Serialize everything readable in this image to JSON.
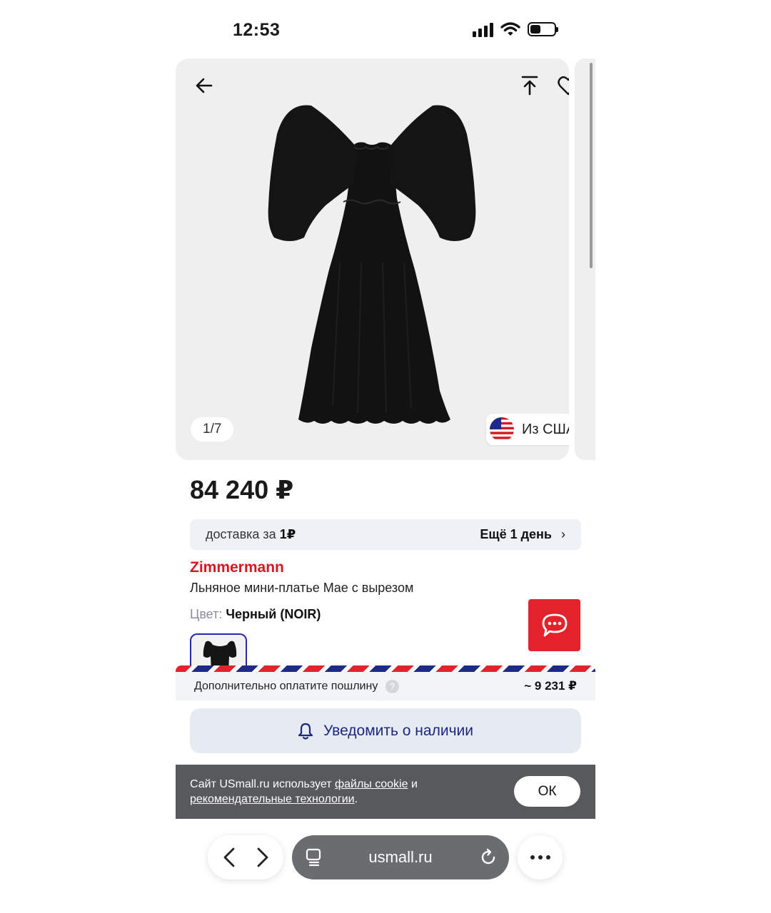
{
  "status_bar": {
    "time": "12:53",
    "battery_level": 0.45
  },
  "gallery": {
    "counter": "1/7",
    "origin_label": "Из США",
    "icons": [
      "arrow-left-icon",
      "share-up-icon",
      "heart-icon",
      "us-flag-icon"
    ]
  },
  "product": {
    "price": "84 240 ₽",
    "delivery": {
      "label": "доставка за",
      "amount": "1₽",
      "eta": "Ещё 1 день",
      "chevron": "›"
    },
    "brand": "Zimmermann",
    "title": "Льняное мини-платье Mae с вырезом",
    "color_label": "Цвет:",
    "color_value": "Черный (NOIR)"
  },
  "duty": {
    "label": "Дополнительно оплатите пошлину",
    "help": "?",
    "value": "~ 9 231 ₽"
  },
  "notify_button": {
    "label": "Уведомить о наличии"
  },
  "cookie": {
    "text_before": "Сайт USmall.ru использует",
    "link1": "файлы cookie",
    "text_middle": "и",
    "link2": "рекомендательные технологии",
    "text_after": ".",
    "ok_label": "ОК"
  },
  "browser": {
    "url": "usmall.ru"
  },
  "colors": {
    "brand_red": "#d31a22",
    "chat_red": "#e4222b",
    "notify_text": "#1e2680",
    "cookie_bg": "#58595d"
  }
}
